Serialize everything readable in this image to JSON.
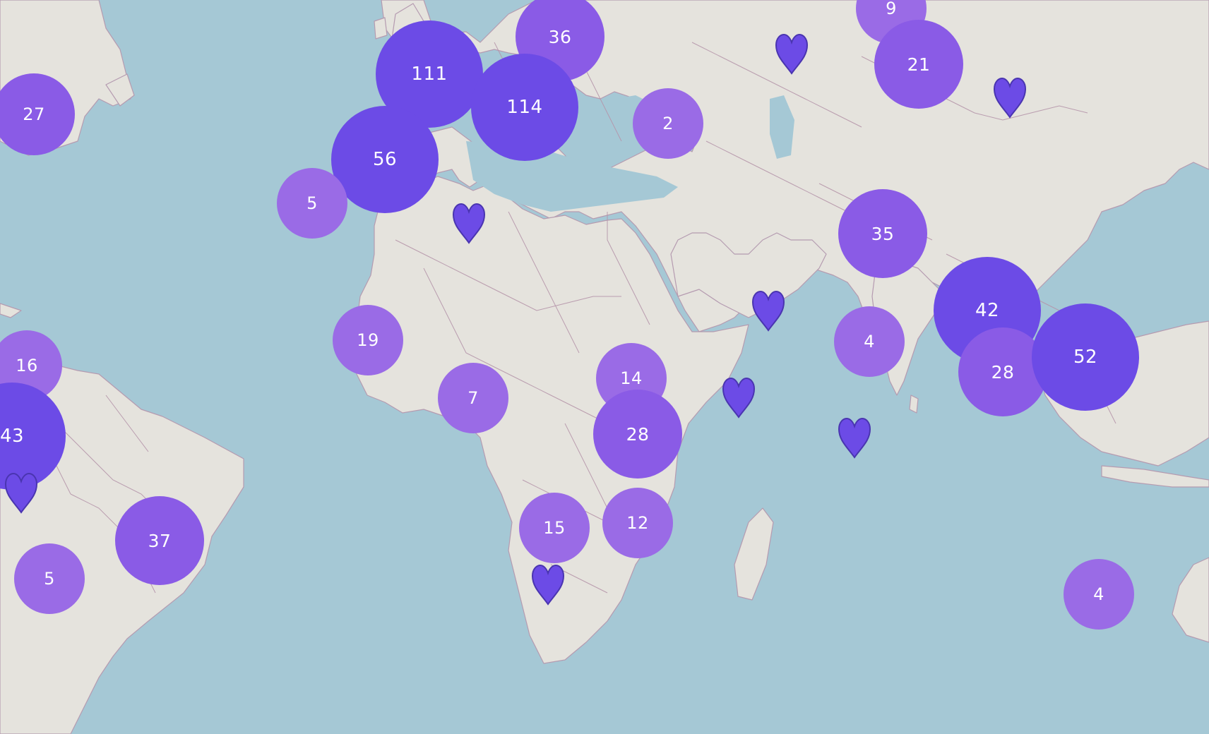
{
  "map": {
    "colors": {
      "water": "#a5c8d5",
      "land": "#e5e3dd",
      "border": "#b595aa",
      "cluster_small": "#9a6be6",
      "cluster_medium": "#8a5be6",
      "cluster_large": "#6c4be6",
      "pin": "#6c4be6",
      "label": "#ffffff"
    },
    "marker_icon": "heart-pin-icon",
    "clusters": [
      {
        "id": "north-atlantic-ca",
        "count": "27"
      },
      {
        "id": "uk",
        "count": "111"
      },
      {
        "id": "poland",
        "count": "36"
      },
      {
        "id": "italy",
        "count": "114"
      },
      {
        "id": "iberia",
        "count": "56"
      },
      {
        "id": "canary",
        "count": "5"
      },
      {
        "id": "caucasus",
        "count": "2"
      },
      {
        "id": "russia-east",
        "count": "9"
      },
      {
        "id": "kazakh",
        "count": "21"
      },
      {
        "id": "india",
        "count": "35"
      },
      {
        "id": "srilanka",
        "count": "4"
      },
      {
        "id": "indochina",
        "count": "42"
      },
      {
        "id": "malaysia",
        "count": "28"
      },
      {
        "id": "indonesia",
        "count": "52"
      },
      {
        "id": "west-africa",
        "count": "19"
      },
      {
        "id": "gulf-guinea",
        "count": "7"
      },
      {
        "id": "east-africa",
        "count": "14"
      },
      {
        "id": "tanzania",
        "count": "28"
      },
      {
        "id": "zambia",
        "count": "15"
      },
      {
        "id": "mozambique",
        "count": "12"
      },
      {
        "id": "colombia",
        "count": "16"
      },
      {
        "id": "peru",
        "count": "43"
      },
      {
        "id": "brazil-south",
        "count": "37"
      },
      {
        "id": "argentina",
        "count": "5"
      },
      {
        "id": "australia-edge",
        "count": "4"
      }
    ],
    "pins": [
      {
        "id": "pin-kazakhstan"
      },
      {
        "id": "pin-mongolia"
      },
      {
        "id": "pin-algeria"
      },
      {
        "id": "pin-arabian-sea"
      },
      {
        "id": "pin-somali-basin"
      },
      {
        "id": "pin-indian-ocean"
      },
      {
        "id": "pin-south-africa"
      },
      {
        "id": "pin-chile"
      }
    ]
  }
}
